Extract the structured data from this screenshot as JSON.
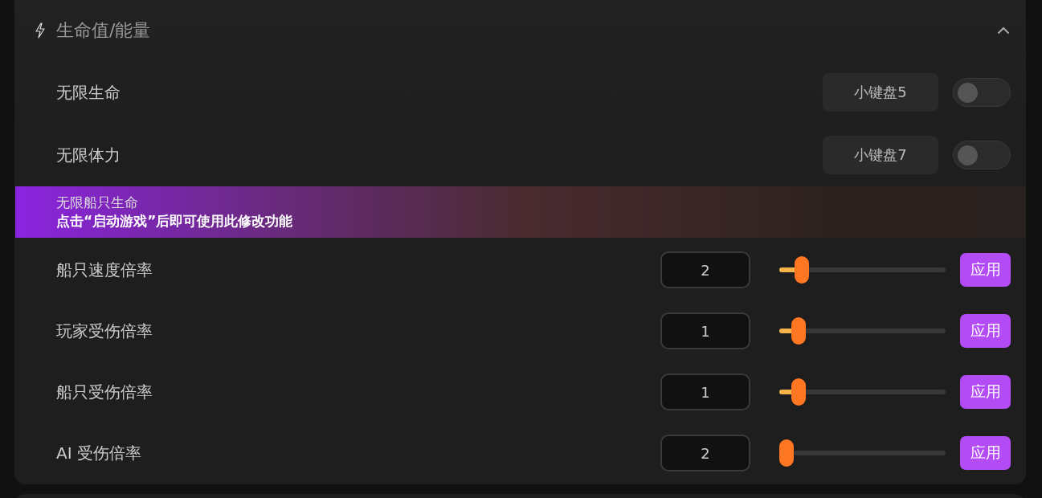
{
  "section": {
    "title": "生命值/能量",
    "expanded": true
  },
  "rows": [
    {
      "kind": "toggle",
      "label": "无限生命",
      "hotkey": "小键盘5",
      "on": false
    },
    {
      "kind": "toggle",
      "label": "无限体力",
      "hotkey": "小键盘7",
      "on": false
    },
    {
      "kind": "locked",
      "label": "无限船只生命",
      "message": "点击“启动游戏”后即可使用此修改功能"
    },
    {
      "kind": "slider",
      "label": "船只速度倍率",
      "value": "2",
      "level": 0.1,
      "button": "应用"
    },
    {
      "kind": "slider",
      "label": "玩家受伤倍率",
      "value": "1",
      "level": 0.08,
      "button": "应用"
    },
    {
      "kind": "slider",
      "label": "船只受伤倍率",
      "value": "1",
      "level": 0.08,
      "button": "应用"
    },
    {
      "kind": "slider",
      "label": "AI 受伤倍率",
      "value": "2",
      "level": 0,
      "button": "应用"
    }
  ]
}
